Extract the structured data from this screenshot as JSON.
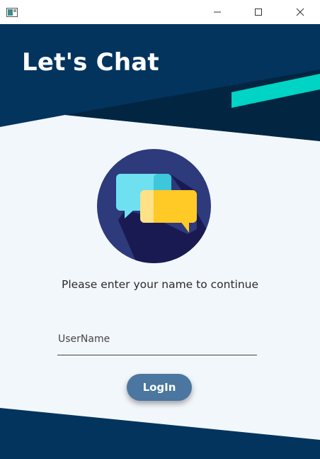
{
  "window": {
    "controls": {
      "minimize_icon": "minimize-icon",
      "maximize_icon": "maximize-icon",
      "close_icon": "close-icon"
    }
  },
  "header": {
    "title": "Let's Chat"
  },
  "login": {
    "prompt": "Please enter your name to continue",
    "username_placeholder": "UserName",
    "username_value": "",
    "button_label": "LogIn"
  },
  "colors": {
    "header_dark": "#03345e",
    "header_shadow": "#022642",
    "accent_teal": "#00d4c4",
    "body_bg": "#f2f7fc",
    "button": "#4a76a0",
    "logo_circle": "#2d3a7c",
    "bubble_cyan": "#6fe0f0",
    "bubble_yellow": "#ffc926"
  }
}
